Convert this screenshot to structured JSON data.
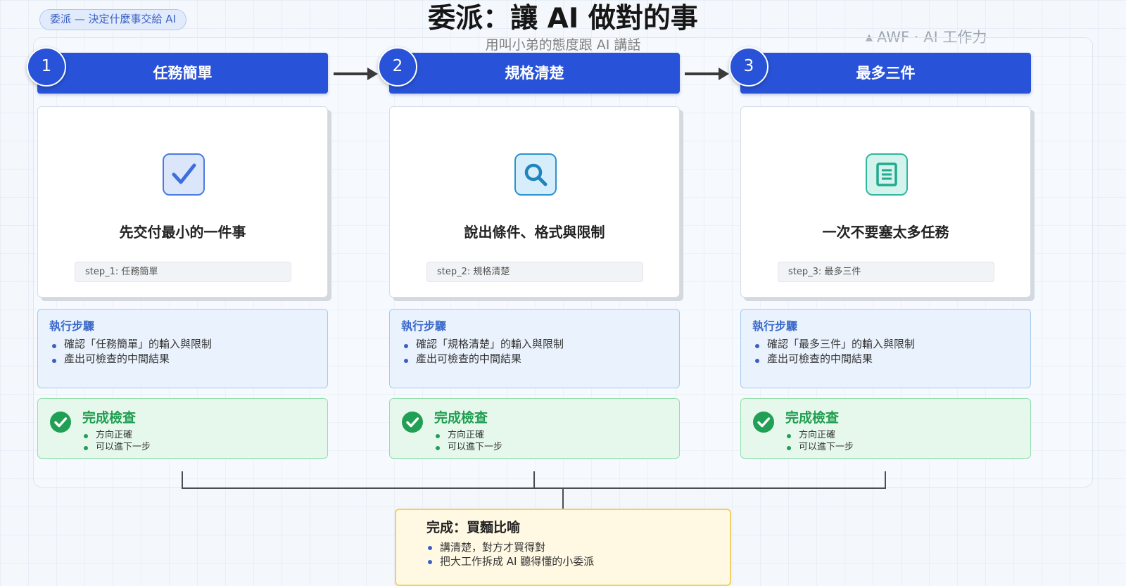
{
  "header": {
    "section_chip": "委派 — 決定什麼事交給 AI",
    "title": "委派：讓 AI 做對的事",
    "subtitle": "用叫小弟的態度跟 AI 講話",
    "brand": "AWF · AI 工作力"
  },
  "steps": [
    {
      "number": "1",
      "title": "任務簡單",
      "icon": "checkbox-icon",
      "card_label": "先交付最小的一件事",
      "tag": "step_1: 任務簡單",
      "exec_title": "執行步驟",
      "exec_items": [
        "確認「任務簡單」的輸入與限制",
        "產出可檢查的中間結果"
      ],
      "check_title": "完成檢查",
      "check_items": [
        "方向正確",
        "可以進下一步"
      ]
    },
    {
      "number": "2",
      "title": "規格清楚",
      "icon": "magnifier-icon",
      "card_label": "說出條件、格式與限制",
      "tag": "step_2: 規格清楚",
      "exec_title": "執行步驟",
      "exec_items": [
        "確認「規格清楚」的輸入與限制",
        "產出可檢查的中間結果"
      ],
      "check_title": "完成檢查",
      "check_items": [
        "方向正確",
        "可以進下一步"
      ]
    },
    {
      "number": "3",
      "title": "最多三件",
      "icon": "document-icon",
      "card_label": "一次不要塞太多任務",
      "tag": "step_3: 最多三件",
      "exec_title": "執行步驟",
      "exec_items": [
        "確認「最多三件」的輸入與限制",
        "產出可檢查的中間結果"
      ],
      "check_title": "完成檢查",
      "check_items": [
        "方向正確",
        "可以進下一步"
      ]
    }
  ],
  "final": {
    "title": "完成：買麵比喻",
    "items": [
      "講清楚，對方才買得對",
      "把大工作拆成 AI 聽得懂的小委派"
    ]
  },
  "colors": {
    "header_blue": "#2853d8",
    "exec_title": "#3b69c9",
    "check_green": "#1e9e4f",
    "final_border": "#f1cf66"
  }
}
